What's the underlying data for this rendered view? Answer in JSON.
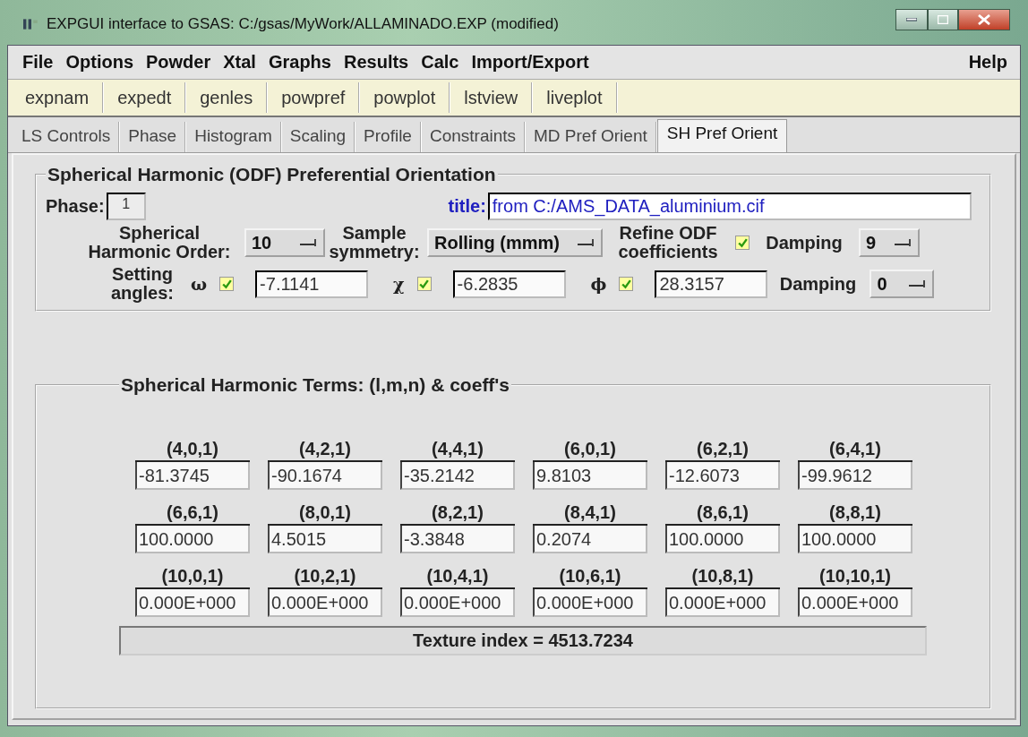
{
  "window": {
    "title": "EXPGUI interface to GSAS: C:/gsas/MyWork/ALLAMINADO.EXP (modified)"
  },
  "menus": {
    "left": [
      "File",
      "Options",
      "Powder",
      "Xtal",
      "Graphs",
      "Results",
      "Calc",
      "Import/Export"
    ],
    "right": [
      "Help"
    ]
  },
  "toolbar": [
    "expnam",
    "expedt",
    "genles",
    "powpref",
    "powplot",
    "lstview",
    "liveplot"
  ],
  "tabs": [
    {
      "label": "LS Controls",
      "selected": false
    },
    {
      "label": "Phase",
      "selected": false
    },
    {
      "label": "Histogram",
      "selected": false
    },
    {
      "label": "Scaling",
      "selected": false
    },
    {
      "label": "Profile",
      "selected": false
    },
    {
      "label": "Constraints",
      "selected": false
    },
    {
      "label": "MD Pref Orient",
      "selected": false
    },
    {
      "label": "SH Pref Orient",
      "selected": true
    }
  ],
  "odf_panel": {
    "title": "Spherical Harmonic (ODF) Preferential Orientation",
    "phase": {
      "label": "Phase:",
      "value": "1"
    },
    "title_field": {
      "label": "title:",
      "value": "from C:/AMS_DATA_aluminium.cif"
    },
    "harmonic_order": {
      "label": "Spherical Harmonic Order:",
      "value": "10"
    },
    "sample_symmetry": {
      "label": "Sample symmetry:",
      "value": "Rolling (mmm)"
    },
    "refine": {
      "label": "Refine ODF coefficients",
      "checked": true
    },
    "odf_damping": {
      "label": "Damping",
      "value": "9"
    },
    "setting_angles": {
      "label": "Setting angles:",
      "angles": [
        {
          "symbol": "ω",
          "checked": true,
          "value": "-7.1141"
        },
        {
          "symbol": "χ",
          "checked": true,
          "value": "-6.2835"
        },
        {
          "symbol": "ϕ",
          "checked": true,
          "value": "28.3157"
        }
      ]
    },
    "angle_damping": {
      "label": "Damping",
      "value": "0"
    }
  },
  "terms_panel": {
    "title": "Spherical Harmonic Terms: (l,m,n) & coeff's",
    "terms": [
      {
        "index": "(4,0,1)",
        "value": "-81.3745"
      },
      {
        "index": "(4,2,1)",
        "value": "-90.1674"
      },
      {
        "index": "(4,4,1)",
        "value": "-35.2142"
      },
      {
        "index": "(6,0,1)",
        "value": "9.8103"
      },
      {
        "index": "(6,2,1)",
        "value": "-12.6073"
      },
      {
        "index": "(6,4,1)",
        "value": "-99.9612"
      },
      {
        "index": "(6,6,1)",
        "value": "100.0000"
      },
      {
        "index": "(8,0,1)",
        "value": "4.5015"
      },
      {
        "index": "(8,2,1)",
        "value": "-3.3848"
      },
      {
        "index": "(8,4,1)",
        "value": "0.2074"
      },
      {
        "index": "(8,6,1)",
        "value": "100.0000"
      },
      {
        "index": "(8,8,1)",
        "value": "100.0000"
      },
      {
        "index": "(10,0,1)",
        "value": "0.000E+000"
      },
      {
        "index": "(10,2,1)",
        "value": "0.000E+000"
      },
      {
        "index": "(10,4,1)",
        "value": "0.000E+000"
      },
      {
        "index": "(10,6,1)",
        "value": "0.000E+000"
      },
      {
        "index": "(10,8,1)",
        "value": "0.000E+000"
      },
      {
        "index": "(10,10,1)",
        "value": "0.000E+000"
      }
    ],
    "texture_index": "Texture index = 4513.7234"
  }
}
